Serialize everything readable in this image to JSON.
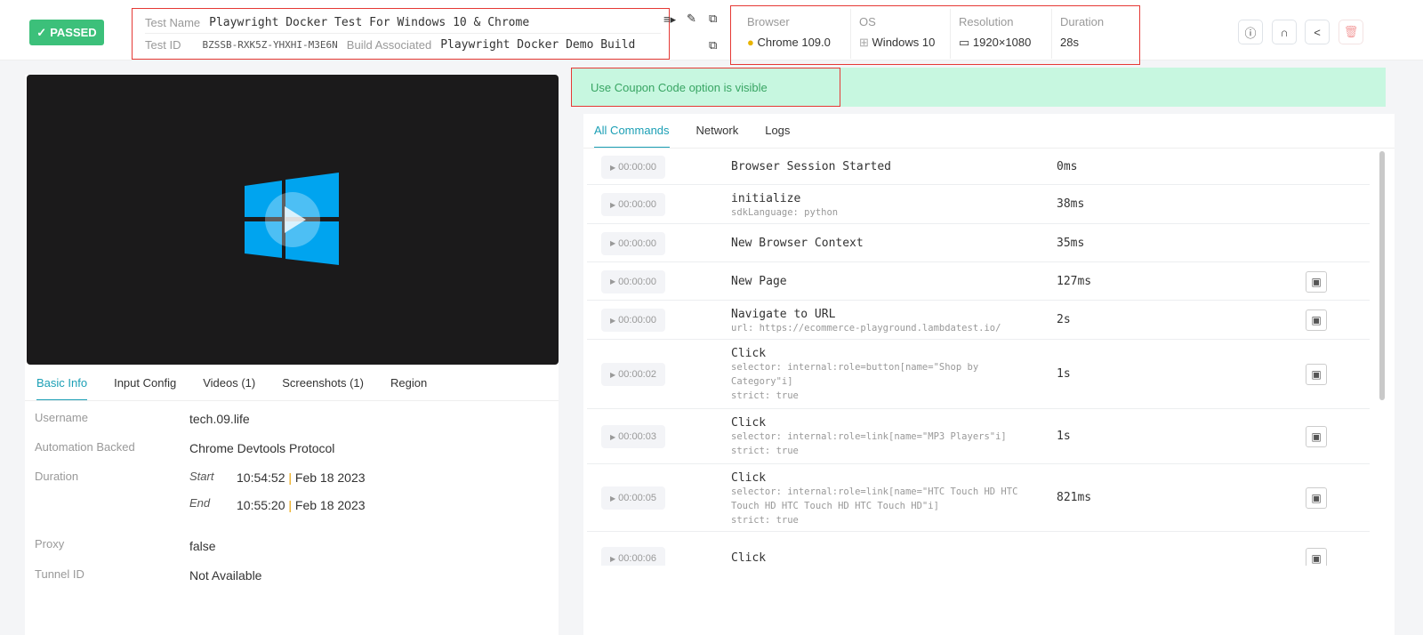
{
  "header": {
    "status": "PASSED",
    "test_name_label": "Test Name",
    "test_name": "Playwright Docker Test For Windows 10 & Chrome",
    "test_id_label": "Test ID",
    "test_id": "BZSSB-RXK5Z-YHXHI-M3E6N",
    "build_label": "Build Associated",
    "build": "Playwright Docker Demo Build",
    "browser_label": "Browser",
    "browser": "Chrome 109.0",
    "os_label": "OS",
    "os": "Windows 10",
    "resolution_label": "Resolution",
    "resolution": "1920×1080",
    "duration_label": "Duration",
    "duration": "28s"
  },
  "banner": "Use Coupon Code option is visible",
  "left_tabs": [
    "Basic Info",
    "Input Config",
    "Videos (1)",
    "Screenshots (1)",
    "Region"
  ],
  "basic_info": {
    "username_label": "Username",
    "username": "tech.09.life",
    "automation_label": "Automation Backed",
    "automation": "Chrome Devtools Protocol",
    "duration_label": "Duration",
    "start_label": "Start",
    "start_time": "10:54:52",
    "start_date": "Feb 18 2023",
    "end_label": "End",
    "end_time": "10:55:20",
    "end_date": "Feb 18 2023",
    "proxy_label": "Proxy",
    "proxy": "false",
    "tunnel_label": "Tunnel ID",
    "tunnel": "Not Available"
  },
  "command_tabs": [
    "All Commands",
    "Network",
    "Logs"
  ],
  "commands": [
    {
      "time": "00:00:00",
      "title": "Browser Session Started",
      "sub": "",
      "dur": "0ms",
      "shot": false
    },
    {
      "time": "00:00:00",
      "title": "initialize",
      "sub": "sdkLanguage: python",
      "dur": "38ms",
      "shot": false
    },
    {
      "time": "00:00:00",
      "title": "New Browser Context",
      "sub": "",
      "dur": "35ms",
      "shot": false
    },
    {
      "time": "00:00:00",
      "title": "New Page",
      "sub": "",
      "dur": "127ms",
      "shot": true
    },
    {
      "time": "00:00:00",
      "title": "Navigate to URL",
      "sub": "url: https://ecommerce-playground.lambdatest.io/",
      "dur": "2s",
      "shot": true
    },
    {
      "time": "00:00:02",
      "title": "Click",
      "sub": "selector: internal:role=button[name=\"Shop by Category\"i]\nstrict: true",
      "dur": "1s",
      "shot": true
    },
    {
      "time": "00:00:03",
      "title": "Click",
      "sub": "selector: internal:role=link[name=\"MP3 Players\"i]\nstrict: true",
      "dur": "1s",
      "shot": true
    },
    {
      "time": "00:00:05",
      "title": "Click",
      "sub": "selector: internal:role=link[name=\"HTC Touch HD HTC Touch HD HTC Touch HD HTC Touch HD\"i]\nstrict: true",
      "dur": "821ms",
      "shot": true
    },
    {
      "time": "00:00:06",
      "title": "Click",
      "sub": "",
      "dur": "",
      "shot": true
    }
  ]
}
